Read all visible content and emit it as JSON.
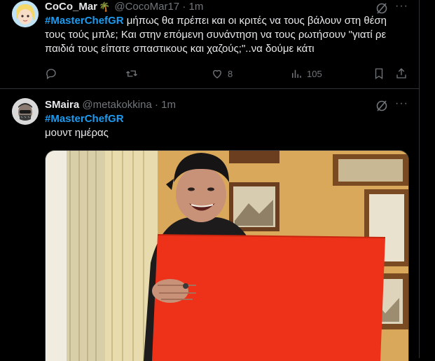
{
  "tweets": [
    {
      "name": "CoCo_Mar",
      "handle": "@CocoMar17",
      "separator": "·",
      "time": "1m",
      "hashtag": "#MasterChefGR",
      "body": " μήπως θα πρέπει και οι κριτές να τους βάλουν στη θέση τους τούς μπλε; Και στην επόμενη συνάντηση να τους ρωτήσουν \"γιατί ρε παιδιά τους είπατε σπαστικους και χαζούς;\"..να δούμε κάτι",
      "actions": {
        "reply_icon": "reply-icon",
        "retweet_icon": "retweet-icon",
        "like_icon": "heart-icon",
        "like_count": "8",
        "views_icon": "views-icon",
        "views_count": "105",
        "bookmark_icon": "bookmark-icon",
        "share_icon": "share-icon"
      }
    },
    {
      "name": "SMaira",
      "handle": "@metakokkina",
      "separator": "·",
      "time": "1m",
      "hashtag": "#MasterChefGR",
      "body": "μουντ ημέρας"
    }
  ],
  "colors": {
    "background": "#000000",
    "text": "#e7e9ea",
    "muted": "#71767b",
    "accent": "#1d9bf0",
    "divider": "#2f3336"
  }
}
